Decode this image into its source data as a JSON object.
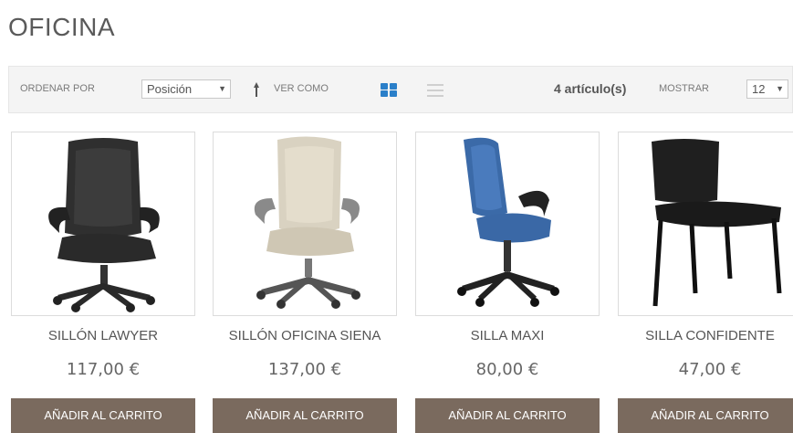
{
  "page": {
    "title": "OFICINA"
  },
  "toolbar": {
    "sort_label": "ORDENAR POR",
    "sort_value": "Posición",
    "view_label": "VER COMO",
    "count_text": "4 artículo(s)",
    "show_label": "MOSTRAR",
    "show_value": "12",
    "grid_color": "#2a7fc9"
  },
  "products": [
    {
      "name": "SILLÓN LAWYER",
      "price": "117,00 €",
      "button": "AÑADIR AL CARRITO",
      "icon": "black-leather-executive-chair"
    },
    {
      "name": "SILLÓN OFICINA SIENA",
      "price": "137,00 €",
      "button": "AÑADIR AL CARRITO",
      "icon": "beige-executive-chair"
    },
    {
      "name": "SILLA MAXI",
      "price": "80,00 €",
      "button": "AÑADIR AL CARRITO",
      "icon": "blue-task-chair"
    },
    {
      "name": "SILLA CONFIDENTE",
      "price": "47,00 €",
      "button": "AÑADIR AL CARRITO",
      "icon": "black-guest-chair"
    }
  ],
  "colors": {
    "button_bg": "#7a6a5e",
    "toolbar_bg": "#f4f4f4"
  }
}
